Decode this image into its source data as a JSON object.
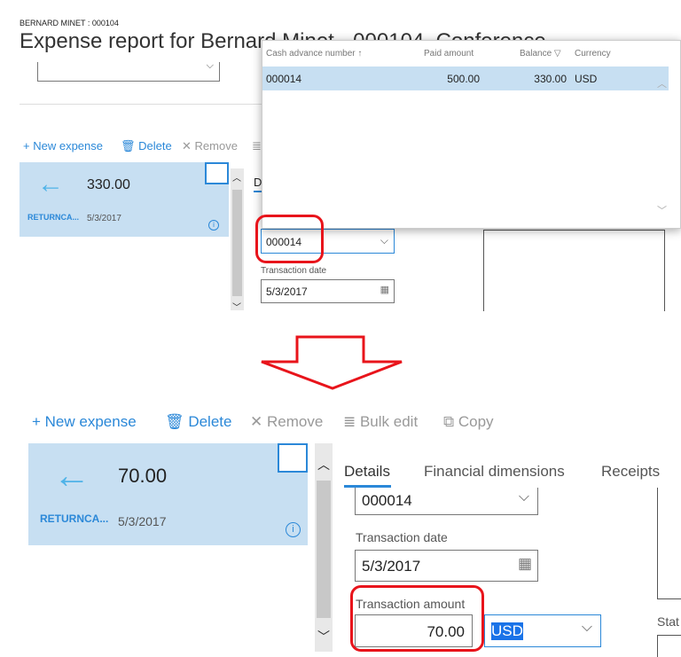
{
  "top": {
    "breadcrumb": "BERNARD MINET : 000104",
    "title": "Expense report for Bernard Minet - 000104, Conference",
    "toolbar": {
      "new_expense": "New expense",
      "delete": "Delete",
      "remove": "Remove"
    },
    "card": {
      "amount": "330.00",
      "category": "RETURNCA...",
      "date": "5/3/2017"
    },
    "tab_partial": "D",
    "cash_advance_field": "000014",
    "transaction_date_label": "Transaction date",
    "transaction_date": "5/3/2017",
    "lookup": {
      "columns": [
        "Cash advance number",
        "Paid amount",
        "Balance",
        "Currency"
      ],
      "rows": [
        {
          "number": "000014",
          "paid": "500.00",
          "balance": "330.00",
          "currency": "USD"
        }
      ]
    }
  },
  "bottom": {
    "toolbar": {
      "new_expense": "New expense",
      "delete": "Delete",
      "remove": "Remove",
      "bulk_edit": "Bulk edit",
      "copy": "Copy"
    },
    "card": {
      "amount": "70.00",
      "category": "RETURNCA...",
      "date": "5/3/2017"
    },
    "tabs": [
      "Details",
      "Financial dimensions",
      "Receipts"
    ],
    "cash_advance_field": "000014",
    "transaction_date_label": "Transaction date",
    "transaction_date": "5/3/2017",
    "transaction_amount_label": "Transaction amount",
    "transaction_amount": "70.00",
    "currency": "USD",
    "status_partial": "Stat"
  },
  "colors": {
    "accent": "#2b88d8",
    "card": "#c7dff2",
    "highlight": "#e8141b"
  }
}
